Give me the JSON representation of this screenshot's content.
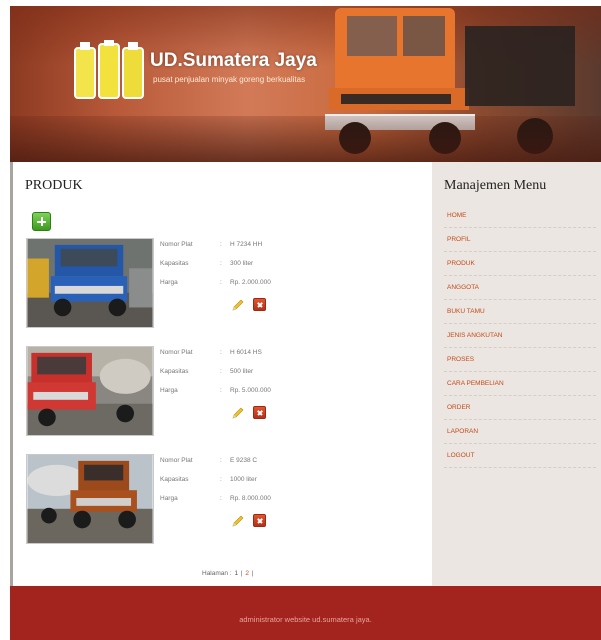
{
  "header": {
    "brand": "UD.Sumatera Jaya",
    "tagline": "pusat penjualan minyak goreng berkualitas"
  },
  "content": {
    "title": "PRODUK",
    "add_icon": "plus-icon",
    "products": [
      {
        "label_plat": "Nomor Plat",
        "plat": "H 7234 HH",
        "label_kapasitas": "Kapasitas",
        "kapasitas": "300 liter",
        "label_harga": "Harga",
        "harga": "Rp. 2.000.000",
        "sep": ":"
      },
      {
        "label_plat": "Nomor Plat",
        "plat": "H 6014 HS",
        "label_kapasitas": "Kapasitas",
        "kapasitas": "500 liter",
        "label_harga": "Harga",
        "harga": "Rp. 5.000.000",
        "sep": ":"
      },
      {
        "label_plat": "Nomor Plat",
        "plat": "E 9238 C",
        "label_kapasitas": "Kapasitas",
        "kapasitas": "1000 liter",
        "label_harga": "Harga",
        "harga": "Rp. 8.000.000",
        "sep": ":"
      }
    ],
    "pagination": {
      "label": "Halaman :",
      "current": "1",
      "divider1": "|",
      "next": "2",
      "divider2": "|"
    }
  },
  "sidebar": {
    "title": "Manajemen Menu",
    "items": [
      "HOME",
      "PROFIL",
      "PRODUK",
      "ANGGOTA",
      "BUKU TAMU",
      "JENIS ANGKUTAN",
      "PROSES",
      "CARA PEMBELIAN",
      "ORDER",
      "LAPORAN",
      "LOGOUT"
    ]
  },
  "footer": {
    "text": "administrator website ud.sumatera jaya."
  },
  "colors": {
    "accent": "#c34a18",
    "footer_bg": "#a3231e",
    "sidebar_bg": "#ebe6e1",
    "add_button": "#4caf2a",
    "delete_button": "#d2442a"
  }
}
